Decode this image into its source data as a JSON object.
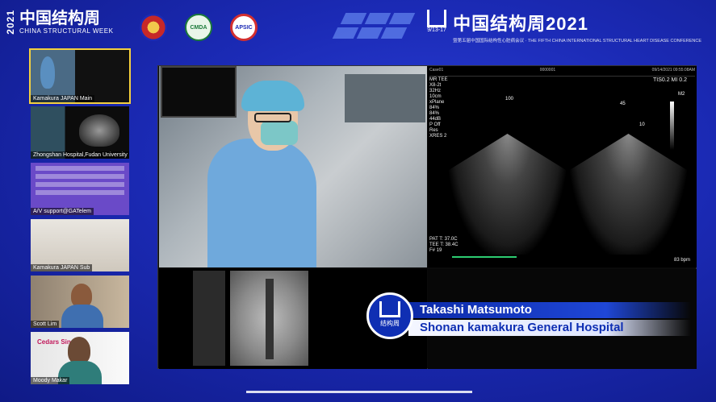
{
  "header": {
    "year_vertical": "2021",
    "brand_cn": "中国结构周",
    "brand_en": "CHINA STRUCTURAL WEEK",
    "logos": [
      "emblem-logo",
      "CMDA",
      "APSIC"
    ],
    "right_title": "中国结构周2021",
    "right_mark_date": "9/13-17",
    "right_subtitle": "暨第五届中国国际结构性心脏病会议 · THE FIFTH CHINA INTERNATIONAL STRUCTURAL HEART DISEASE CONFERENCE"
  },
  "sidebar": {
    "tiles": [
      {
        "label": "Kamakura JAPAN Main",
        "active": true
      },
      {
        "label": "Zhongshan Hospital,Fudan University",
        "active": false
      },
      {
        "label": "A/V support@GATelem",
        "active": false
      },
      {
        "label": "Kamakura JAPAN Sub",
        "active": false
      },
      {
        "label": "Scott Lim",
        "active": false
      },
      {
        "label": "Moody Makar",
        "active": false
      }
    ],
    "sinai_text": "Cedars Sinai"
  },
  "echo": {
    "header_left": "Case01",
    "header_mid": "0000001",
    "header_right": "09/14/2021 09:55:08AM",
    "probe": "MR TEE",
    "params": [
      "X8-2t",
      "32Hz",
      "10cm",
      "xPlane",
      "84%",
      "84%",
      "44dB",
      "P Off",
      "Res",
      "XRES 2"
    ],
    "tis": "TIS0.2  MI  0.2",
    "plane_a": "100",
    "plane_b_1": "45",
    "plane_b_2": "10",
    "pat_temp": "PAT T: 37.0C",
    "tee_temp": "TEE T: 38.4C",
    "frame": "F# 19",
    "hr": "83 bpm",
    "m2": "M2"
  },
  "speaker": {
    "name": "Takashi Matsumoto",
    "hospital": "Shonan kamakura General Hospital",
    "badge_text": "结构周"
  },
  "colors": {
    "background": "#1b2ab5",
    "active_tile": "#f4d03f",
    "banner_name_bg": "#0c2aa8",
    "banner_hosp_text": "#0f2fb3"
  }
}
